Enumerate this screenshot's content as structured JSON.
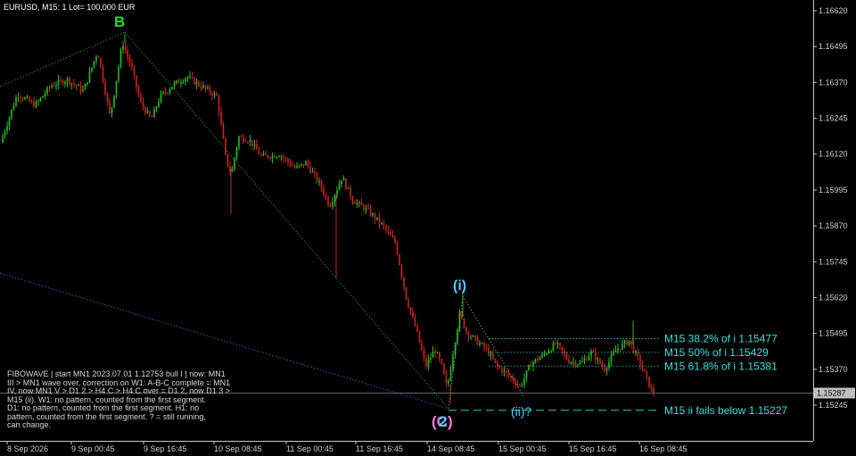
{
  "header": {
    "symbol_line": "EURUSD, M15:  1 Lot= 100,000 EUR"
  },
  "colors": {
    "background": "#000000",
    "bull": "#22c022",
    "bear": "#d02020",
    "wave_label": "#4fd0ff",
    "b_label": "#22dd22",
    "fib_level": "#33e0e0",
    "axis_text": "#d0d0d0",
    "price_tag_bg": "#c0c0c0"
  },
  "price_axis": {
    "ticks": [
      "1.16620",
      "1.16495",
      "1.16370",
      "1.16245",
      "1.16120",
      "1.15995",
      "1.15870",
      "1.15745",
      "1.15620",
      "1.15495",
      "1.15370",
      "1.15245"
    ],
    "current_price": "1.15287"
  },
  "time_axis": {
    "ticks": [
      "8 Sep 2026",
      "9 Sep 00:45",
      "9 Sep 16:45",
      "10 Sep 08:45",
      "11 Sep 00:45",
      "11 Sep 16:45",
      "14 Sep 08:45",
      "15 Sep 00:45",
      "15 Sep 16:45",
      "16 Sep 08:45"
    ]
  },
  "wave_labels": {
    "b": "B",
    "i": "(i)",
    "ii": "(ii)?",
    "c2_a": "(C)",
    "c2_b": "2"
  },
  "fib_levels": [
    {
      "label": "M15 38.2% of i  1.15477",
      "price": 1.15477,
      "style": "dotted"
    },
    {
      "label": "M15 50% of i  1.15429",
      "price": 1.15429,
      "style": "dotted"
    },
    {
      "label": "M15 61.8% of i  1.15381",
      "price": 1.15381,
      "style": "dotted"
    },
    {
      "label": "M15 ii fails below 1.15227",
      "price": 1.15227,
      "style": "dashed"
    }
  ],
  "info_lines": [
    "FIBOWAVE | start MN1 2023.07.01 1.12753 bull I | now: MN1",
    "III > MN1 wave over, correction on W1: A-B-C complete = MN1",
    "IV, now MN1 V > D1 2 > H4 C > H4 C over = D1 2, now D1 3 >",
    "M15 (ii). W1: no pattern, counted from the first segment.",
    "D1: no pattern, counted from the first segment.  H1: no",
    "pattern, counted from the first segment.  ? = still running,",
    "can change."
  ]
}
